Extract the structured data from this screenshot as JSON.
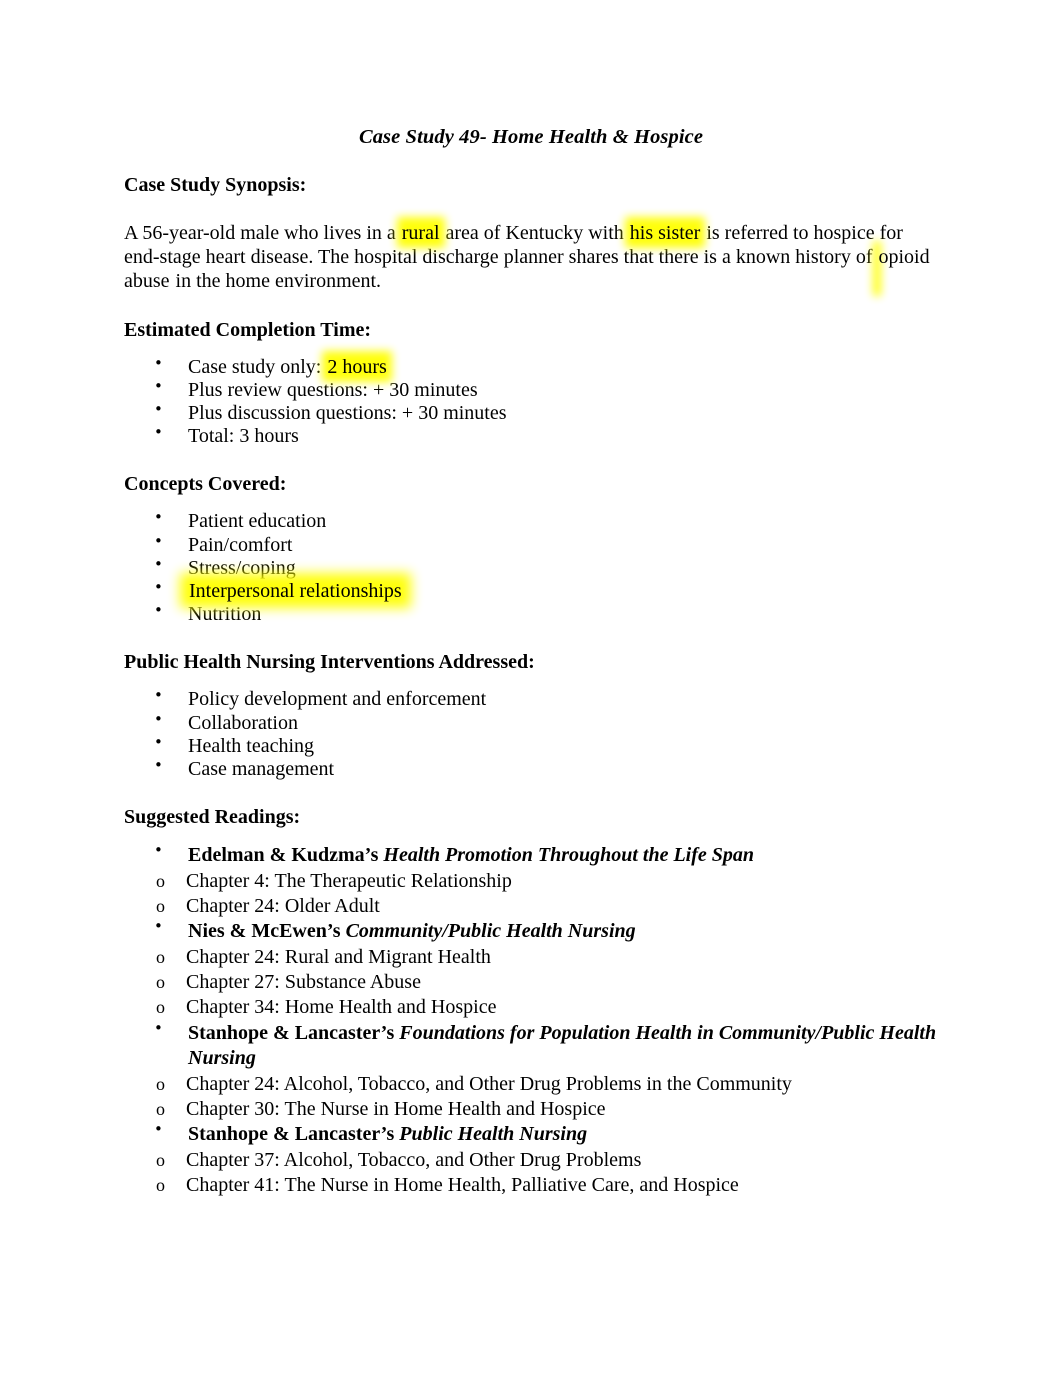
{
  "document": {
    "title": "Case Study 49- Home Health & Hospice",
    "highlight_color": "#ffff00",
    "sections": {
      "synopsis": {
        "heading": "Case Study Synopsis:",
        "text_part_1": "A 56-year-old male who lives in a ",
        "highlight_1": "rural",
        "text_part_2": " area of Kentucky with ",
        "highlight_2": "his sister",
        "text_part_3": " is referred to hospice for end-stage heart disease. The hospital discharge planner shares that there is a known history of ",
        "highlight_3": "opioid abuse",
        "text_part_4": " in the home environment."
      },
      "estimated_time": {
        "heading": "Estimated Completion Time:",
        "items": [
          {
            "prefix": "Case study only: ",
            "highlight": "2 hours",
            "suffix": ""
          },
          {
            "prefix": "Plus review questions: + 30 minutes",
            "highlight": "",
            "suffix": ""
          },
          {
            "prefix": "Plus discussion questions: + 30 minutes",
            "highlight": "",
            "suffix": ""
          },
          {
            "prefix": "Total: 3 hours",
            "highlight": "",
            "suffix": ""
          }
        ]
      },
      "concepts": {
        "heading": "Concepts Covered:",
        "items": [
          {
            "label": "Patient education",
            "highlighted": false
          },
          {
            "label": "Pain/comfort",
            "highlighted": false
          },
          {
            "label": "Stress/coping",
            "highlighted": false
          },
          {
            "label": "Interpersonal relationships",
            "highlighted": true
          },
          {
            "label": "Nutrition",
            "highlighted": false
          }
        ]
      },
      "interventions": {
        "heading": "Public Health Nursing Interventions Addressed:",
        "items": [
          {
            "label": "Policy development and enforcement"
          },
          {
            "label": "Collaboration"
          },
          {
            "label": "Health teaching"
          },
          {
            "label": "Case management"
          }
        ]
      },
      "readings": {
        "heading": "Suggested Readings:",
        "items": [
          {
            "author": "Edelman & Kudzma’s ",
            "book": "Health Promotion Throughout the Life Span",
            "chapters": [
              "Chapter 4: The Therapeutic Relationship",
              "Chapter 24: Older Adult"
            ]
          },
          {
            "author": "Nies & McEwen’s ",
            "book": "Community/Public Health Nursing",
            "chapters": [
              "Chapter 24: Rural and Migrant Health",
              "Chapter 27: Substance Abuse",
              "Chapter 34: Home Health and Hospice"
            ]
          },
          {
            "author": "Stanhope & Lancaster’s ",
            "book": "Foundations for Population Health in Community/Public Health Nursing",
            "chapters": [
              "Chapter 24: Alcohol, Tobacco, and Other Drug Problems in the Community",
              "Chapter 30: The Nurse in Home Health and Hospice"
            ]
          },
          {
            "author": "Stanhope & Lancaster’s ",
            "book": "Public Health Nursing",
            "chapters": [
              "Chapter 37: Alcohol, Tobacco, and Other Drug Problems",
              "Chapter 41: The Nurse in Home Health, Palliative Care, and Hospice"
            ]
          }
        ]
      }
    },
    "bullet_glyph": "•",
    "sub_bullet_glyph": "o"
  }
}
